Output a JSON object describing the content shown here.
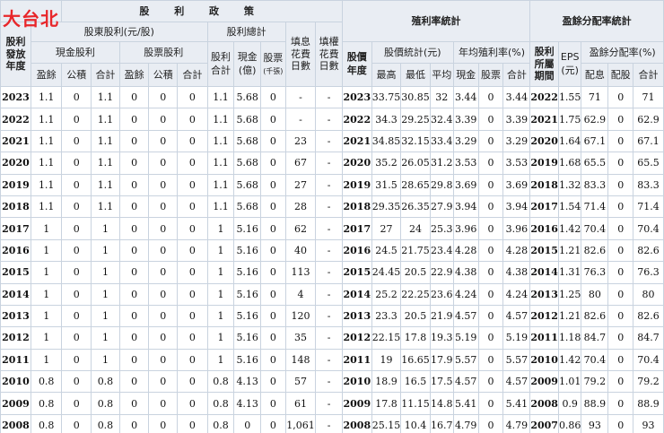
{
  "company": "大台北",
  "headers": {
    "policy": "股 利 政 策",
    "yield_stats": "殖利率統計",
    "payout_stats": "盈餘分配率統計",
    "dividend_year": "股利發放年度",
    "shareholder_dividend": "股東股利(元/股)",
    "dividend_total": "股利總計",
    "fill_days_interest": "填息花費日數",
    "fill_days_rights": "填權花費日數",
    "price_year": "股價年度",
    "price_stats": "股價統計(元)",
    "avg_yield": "年均殖利率(%)",
    "dividend_period": "股利所屬期間",
    "eps": "EPS",
    "eps_unit": "(元)",
    "payout_ratio": "盈餘分配率(%)",
    "cash_dividend": "現金股利",
    "stock_dividend": "股票股利",
    "earnings": "盈餘",
    "reserve": "公積",
    "sum": "合計",
    "dividend_sum": "股利合計",
    "cash_billion": "現金(億)",
    "stock": "股票",
    "stock_unit": "(千張)",
    "high": "最高",
    "low": "最低",
    "average": "平均",
    "cash": "現金",
    "stock2": "股票",
    "total": "合計",
    "pay_cash": "配息",
    "pay_stock": "配股",
    "pay_total": "合計"
  },
  "rows": [
    [
      "2023",
      "1.1",
      "0",
      "1.1",
      "0",
      "0",
      "0",
      "1.1",
      "5.68",
      "0",
      "-",
      "-",
      "2023",
      "33.75",
      "30.85",
      "32",
      "3.44",
      "0",
      "3.44",
      "2022",
      "1.55",
      "71",
      "0",
      "71"
    ],
    [
      "2022",
      "1.1",
      "0",
      "1.1",
      "0",
      "0",
      "0",
      "1.1",
      "5.68",
      "0",
      "-",
      "-",
      "2022",
      "34.3",
      "29.25",
      "32.4",
      "3.39",
      "0",
      "3.39",
      "2021",
      "1.75",
      "62.9",
      "0",
      "62.9"
    ],
    [
      "2021",
      "1.1",
      "0",
      "1.1",
      "0",
      "0",
      "0",
      "1.1",
      "5.68",
      "0",
      "23",
      "-",
      "2021",
      "34.85",
      "32.15",
      "33.4",
      "3.29",
      "0",
      "3.29",
      "2020",
      "1.64",
      "67.1",
      "0",
      "67.1"
    ],
    [
      "2020",
      "1.1",
      "0",
      "1.1",
      "0",
      "0",
      "0",
      "1.1",
      "5.68",
      "0",
      "67",
      "-",
      "2020",
      "35.2",
      "26.05",
      "31.2",
      "3.53",
      "0",
      "3.53",
      "2019",
      "1.68",
      "65.5",
      "0",
      "65.5"
    ],
    [
      "2019",
      "1.1",
      "0",
      "1.1",
      "0",
      "0",
      "0",
      "1.1",
      "5.68",
      "0",
      "27",
      "-",
      "2019",
      "31.5",
      "28.65",
      "29.8",
      "3.69",
      "0",
      "3.69",
      "2018",
      "1.32",
      "83.3",
      "0",
      "83.3"
    ],
    [
      "2018",
      "1.1",
      "0",
      "1.1",
      "0",
      "0",
      "0",
      "1.1",
      "5.68",
      "0",
      "28",
      "-",
      "2018",
      "29.35",
      "26.35",
      "27.9",
      "3.94",
      "0",
      "3.94",
      "2017",
      "1.54",
      "71.4",
      "0",
      "71.4"
    ],
    [
      "2017",
      "1",
      "0",
      "1",
      "0",
      "0",
      "0",
      "1",
      "5.16",
      "0",
      "62",
      "-",
      "2017",
      "27",
      "24",
      "25.3",
      "3.96",
      "0",
      "3.96",
      "2016",
      "1.42",
      "70.4",
      "0",
      "70.4"
    ],
    [
      "2016",
      "1",
      "0",
      "1",
      "0",
      "0",
      "0",
      "1",
      "5.16",
      "0",
      "40",
      "-",
      "2016",
      "24.5",
      "21.75",
      "23.4",
      "4.28",
      "0",
      "4.28",
      "2015",
      "1.21",
      "82.6",
      "0",
      "82.6"
    ],
    [
      "2015",
      "1",
      "0",
      "1",
      "0",
      "0",
      "0",
      "1",
      "5.16",
      "0",
      "113",
      "-",
      "2015",
      "24.45",
      "20.5",
      "22.9",
      "4.38",
      "0",
      "4.38",
      "2014",
      "1.31",
      "76.3",
      "0",
      "76.3"
    ],
    [
      "2014",
      "1",
      "0",
      "1",
      "0",
      "0",
      "0",
      "1",
      "5.16",
      "0",
      "4",
      "-",
      "2014",
      "25.2",
      "22.25",
      "23.6",
      "4.24",
      "0",
      "4.24",
      "2013",
      "1.25",
      "80",
      "0",
      "80"
    ],
    [
      "2013",
      "1",
      "0",
      "1",
      "0",
      "0",
      "0",
      "1",
      "5.16",
      "0",
      "120",
      "-",
      "2013",
      "23.3",
      "20.5",
      "21.9",
      "4.57",
      "0",
      "4.57",
      "2012",
      "1.21",
      "82.6",
      "0",
      "82.6"
    ],
    [
      "2012",
      "1",
      "0",
      "1",
      "0",
      "0",
      "0",
      "1",
      "5.16",
      "0",
      "35",
      "-",
      "2012",
      "22.15",
      "17.8",
      "19.3",
      "5.19",
      "0",
      "5.19",
      "2011",
      "1.18",
      "84.7",
      "0",
      "84.7"
    ],
    [
      "2011",
      "1",
      "0",
      "1",
      "0",
      "0",
      "0",
      "1",
      "5.16",
      "0",
      "148",
      "-",
      "2011",
      "19",
      "16.65",
      "17.9",
      "5.57",
      "0",
      "5.57",
      "2010",
      "1.42",
      "70.4",
      "0",
      "70.4"
    ],
    [
      "2010",
      "0.8",
      "0",
      "0.8",
      "0",
      "0",
      "0",
      "0.8",
      "4.13",
      "0",
      "57",
      "-",
      "2010",
      "18.9",
      "16.5",
      "17.5",
      "4.57",
      "0",
      "4.57",
      "2009",
      "1.01",
      "79.2",
      "0",
      "79.2"
    ],
    [
      "2009",
      "0.8",
      "0",
      "0.8",
      "0",
      "0",
      "0",
      "0.8",
      "4.13",
      "0",
      "61",
      "-",
      "2009",
      "17.8",
      "11.15",
      "14.8",
      "5.41",
      "0",
      "5.41",
      "2008",
      "0.9",
      "88.9",
      "0",
      "88.9"
    ],
    [
      "2008",
      "0.8",
      "0",
      "0.8",
      "0",
      "0",
      "0",
      "0.8",
      "0",
      "0",
      "1,061",
      "-",
      "2008",
      "25.15",
      "10.4",
      "16.7",
      "4.79",
      "0",
      "4.79",
      "2007",
      "0.86",
      "93",
      "0",
      "93"
    ]
  ]
}
